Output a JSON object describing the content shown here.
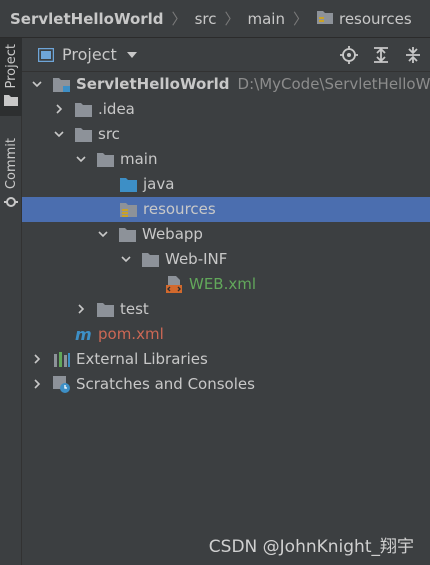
{
  "breadcrumbs": [
    "ServletHelloWorld",
    "src",
    "main",
    "resources"
  ],
  "stripe": {
    "project_label": "Project",
    "commit_label": "Commit"
  },
  "panel": {
    "title": "Project"
  },
  "tree": [
    {
      "label": "ServletHelloWorld",
      "path": "D:\\MyCode\\ServletHelloWorld",
      "icon": "module-folder-icon",
      "chevron": "down"
    },
    {
      "label": ".idea",
      "icon": "folder-icon",
      "chevron": "right"
    },
    {
      "label": "src",
      "icon": "folder-icon",
      "chevron": "down"
    },
    {
      "label": "main",
      "icon": "folder-icon",
      "chevron": "down"
    },
    {
      "label": "java",
      "icon": "source-folder-icon",
      "chevron": "none"
    },
    {
      "label": "resources",
      "icon": "resources-folder-icon",
      "chevron": "none",
      "selected": true
    },
    {
      "label": "Webapp",
      "icon": "folder-icon",
      "chevron": "down"
    },
    {
      "label": "Web-INF",
      "icon": "folder-icon",
      "chevron": "down"
    },
    {
      "label": "WEB.xml",
      "icon": "xml-file-icon",
      "chevron": "none"
    },
    {
      "label": "test",
      "icon": "folder-icon",
      "chevron": "right"
    },
    {
      "label": "pom.xml",
      "icon": "maven-icon",
      "chevron": "none"
    },
    {
      "label": "External Libraries",
      "icon": "libraries-icon",
      "chevron": "right"
    },
    {
      "label": "Scratches and Consoles",
      "icon": "scratches-icon",
      "chevron": "right"
    }
  ],
  "watermark": "CSDN @JohnKnight_翔宇",
  "colors": {
    "selection": "#4b6eaf",
    "green_file": "#62a85b",
    "red_file": "#cc6855",
    "folder": "#8d9299",
    "source_folder": "#3d8fc6"
  }
}
